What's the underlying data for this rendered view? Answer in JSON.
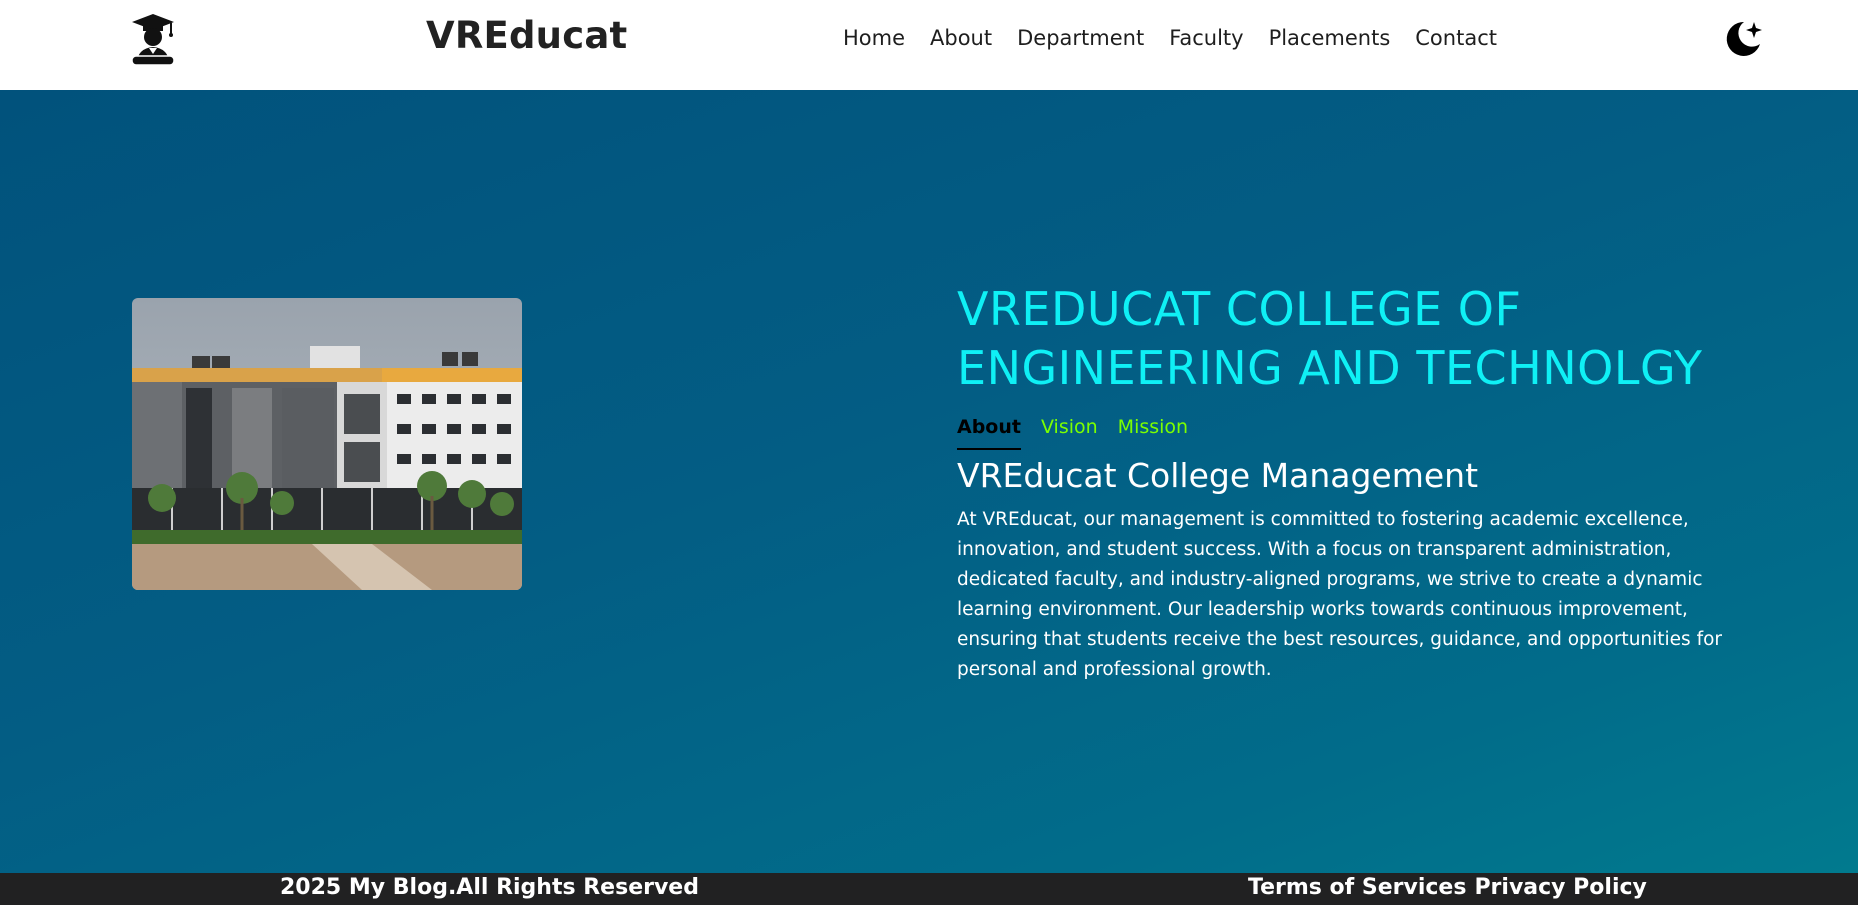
{
  "header": {
    "brand": "VREducat",
    "logo_icon": "graduate-icon",
    "nav": [
      "Home",
      "About",
      "Department",
      "Faculty",
      "Placements",
      "Contact"
    ],
    "theme_icon": "moon-star-icon"
  },
  "hero": {
    "title": "VREDUCAT COLLEGE OF ENGINEERING AND TECHNOLGY",
    "image_icon": "college-building-photo",
    "tabs": [
      "About",
      "Vision",
      "Mission"
    ],
    "active_tab": "About",
    "heading": "VREducat College Management",
    "body": "At VREducat, our management is committed to fostering academic excellence, innovation, and student success. With a focus on transparent administration, dedicated faculty, and industry-aligned programs, we strive to create a dynamic learning environment. Our leadership works towards continuous improvement, ensuring that students receive the best resources, guidance, and opportunities for personal and professional growth."
  },
  "footer": {
    "copyright": "2025 My Blog.All Rights Reserved",
    "links": [
      "Terms of Services",
      "Privacy Policy"
    ]
  },
  "colors": {
    "hero_gradient_start": "#01527c",
    "hero_gradient_end": "#017a8e",
    "title": "#0ff0f5",
    "tab_inactive": "#7cff00",
    "footer_bg": "#212122"
  }
}
